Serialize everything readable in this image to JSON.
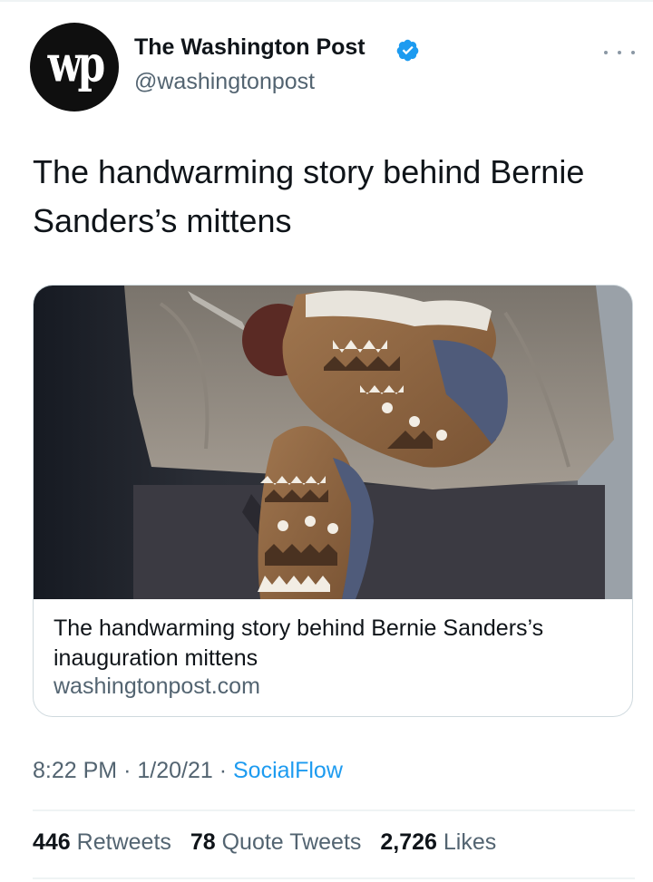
{
  "account": {
    "avatar_text": "wp",
    "display_name": "The Washington Post",
    "handle": "@washingtonpost",
    "verified": true
  },
  "tweet": {
    "text": "The handwarming story behind Bernie Sanders’s mittens"
  },
  "link_card": {
    "image_description": "Close-up of hands in knitted brown and white patterned mittens crossed in front of a tan jacket",
    "title": "The handwarming story behind Bernie Sanders’s inauguration mittens",
    "domain": "washingtonpost.com"
  },
  "meta": {
    "time": "8:22 PM",
    "date": "1/20/21",
    "separator": "·",
    "source": "SocialFlow"
  },
  "stats": {
    "retweets_count": "446",
    "retweets_label": "Retweets",
    "quotes_count": "78",
    "quotes_label": "Quote Tweets",
    "likes_count": "2,726",
    "likes_label": "Likes"
  },
  "colors": {
    "text_primary": "#0f1419",
    "text_secondary": "#536471",
    "link_blue": "#1d9bf0",
    "border": "#cfd9de"
  },
  "icons": {
    "verified": "verified-badge-icon",
    "more": "more-options-icon"
  }
}
